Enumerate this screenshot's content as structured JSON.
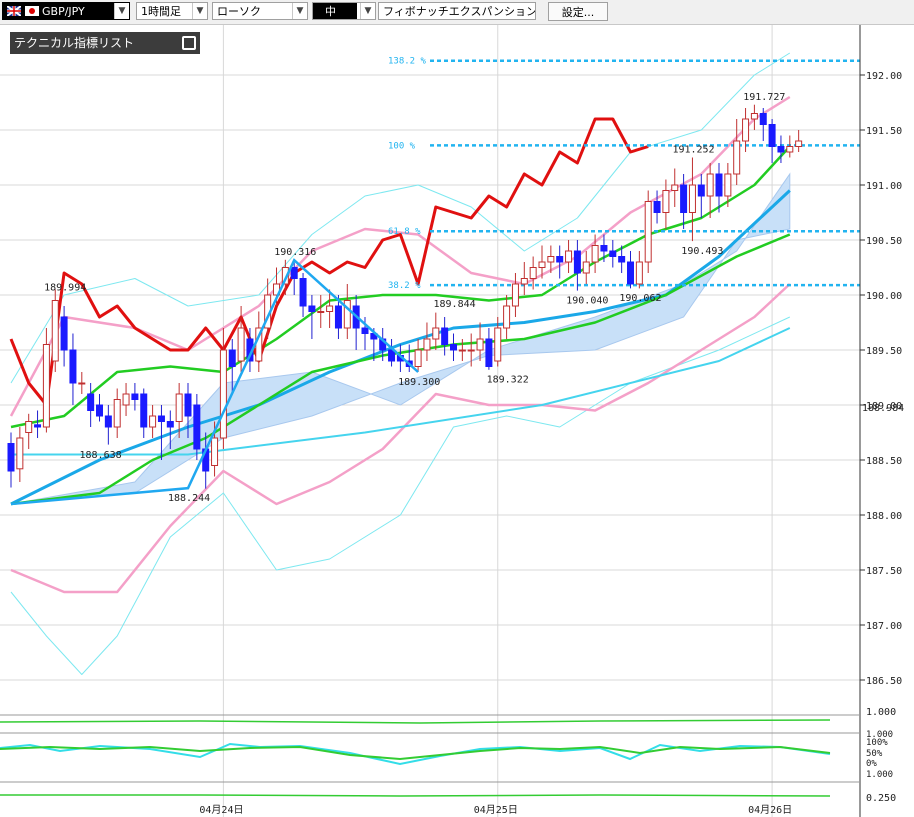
{
  "toolbar": {
    "pair": "GBP/JPY",
    "timeframe": "1時間足",
    "chart_type": "ローソク",
    "size": "中",
    "drawing_tool": "フィボナッチエクスパンション",
    "settings_label": "設定..."
  },
  "indicator_list": {
    "label": "テクニカル指標リスト"
  },
  "chart_data": {
    "type": "candlestick",
    "price_axis": {
      "min": 186.5,
      "max": 192.0,
      "ticks": [
        "192.00",
        "191.50",
        "191.00",
        "190.50",
        "190.00",
        "189.50",
        "189.00",
        "188.50",
        "188.00",
        "187.50",
        "187.00",
        "186.50"
      ]
    },
    "date_labels": [
      {
        "label": "04月24日",
        "index": 24
      },
      {
        "label": "04月25日",
        "index": 55
      },
      {
        "label": "04月26日",
        "index": 86
      }
    ],
    "fibonacci_expansion": [
      {
        "label": "138.2 %",
        "price": 192.13
      },
      {
        "label": "100 %",
        "price": 191.36
      },
      {
        "label": "61.8 %",
        "price": 190.58
      },
      {
        "label": "38.2 %",
        "price": 190.09
      }
    ],
    "price_labels": [
      {
        "text": "189.994",
        "index": 6,
        "price": 189.994,
        "pos": "above"
      },
      {
        "text": "188.638",
        "index": 10,
        "price": 188.638,
        "pos": "below"
      },
      {
        "text": "188.244",
        "index": 20,
        "price": 188.244,
        "pos": "below"
      },
      {
        "text": "190.316",
        "index": 32,
        "price": 190.316,
        "pos": "above"
      },
      {
        "text": "189.844",
        "index": 50,
        "price": 189.844,
        "pos": "above"
      },
      {
        "text": "189.300",
        "index": 46,
        "price": 189.3,
        "pos": "below"
      },
      {
        "text": "189.322",
        "index": 56,
        "price": 189.322,
        "pos": "below"
      },
      {
        "text": "190.040",
        "index": 65,
        "price": 190.04,
        "pos": "below"
      },
      {
        "text": "190.062",
        "index": 71,
        "price": 190.062,
        "pos": "below"
      },
      {
        "text": "191.252",
        "index": 77,
        "price": 191.252,
        "pos": "above"
      },
      {
        "text": "190.493",
        "index": 78,
        "price": 190.493,
        "pos": "below"
      },
      {
        "text": "191.727",
        "index": 85,
        "price": 191.727,
        "pos": "above"
      }
    ],
    "current_price_label": "188.984",
    "zigzag": [
      [
        0,
        188.1
      ],
      [
        20,
        188.244
      ],
      [
        32,
        190.316
      ],
      [
        46,
        189.3
      ]
    ],
    "candles": [
      [
        188.65,
        188.4,
        188.75,
        188.25
      ],
      [
        188.42,
        188.7,
        188.8,
        188.3
      ],
      [
        188.75,
        188.85,
        188.92,
        188.6
      ],
      [
        188.82,
        188.8,
        188.95,
        188.7
      ],
      [
        188.8,
        189.55,
        189.7,
        188.75
      ],
      [
        189.4,
        189.95,
        190.05,
        189.3
      ],
      [
        189.8,
        189.5,
        189.9,
        189.35
      ],
      [
        189.5,
        189.2,
        189.65,
        189.0
      ],
      [
        189.2,
        189.2,
        189.3,
        189.1
      ],
      [
        189.1,
        188.95,
        189.2,
        188.8
      ],
      [
        189.0,
        188.9,
        189.1,
        188.85
      ],
      [
        188.9,
        188.8,
        189.0,
        188.64
      ],
      [
        188.8,
        189.05,
        189.15,
        188.7
      ],
      [
        189.0,
        189.1,
        189.2,
        188.9
      ],
      [
        189.1,
        189.05,
        189.2,
        188.95
      ],
      [
        189.1,
        188.8,
        189.15,
        188.7
      ],
      [
        188.8,
        188.9,
        189.0,
        188.7
      ],
      [
        188.9,
        188.85,
        189.0,
        188.5
      ],
      [
        188.85,
        188.8,
        188.95,
        188.6
      ],
      [
        188.85,
        189.1,
        189.2,
        188.7
      ],
      [
        189.1,
        188.9,
        189.2,
        188.7
      ],
      [
        189.0,
        188.6,
        189.1,
        188.5
      ],
      [
        188.6,
        188.4,
        188.75,
        188.24
      ],
      [
        188.45,
        188.7,
        188.85,
        188.35
      ],
      [
        188.7,
        189.5,
        189.7,
        188.6
      ],
      [
        189.5,
        189.35,
        189.6,
        189.1
      ],
      [
        189.4,
        189.7,
        189.9,
        189.3
      ],
      [
        189.6,
        189.4,
        189.7,
        189.3
      ],
      [
        189.4,
        189.7,
        189.85,
        189.3
      ],
      [
        189.7,
        190.0,
        190.15,
        189.6
      ],
      [
        190.0,
        190.1,
        190.25,
        189.9
      ],
      [
        190.1,
        190.25,
        190.32,
        190.0
      ],
      [
        190.25,
        190.15,
        190.3,
        190.0
      ],
      [
        190.15,
        189.9,
        190.2,
        189.8
      ],
      [
        189.9,
        189.85,
        190.0,
        189.6
      ],
      [
        189.85,
        189.85,
        190.0,
        189.7
      ],
      [
        189.85,
        189.9,
        190.05,
        189.7
      ],
      [
        189.9,
        189.7,
        190.0,
        189.6
      ],
      [
        189.7,
        189.95,
        190.1,
        189.6
      ],
      [
        189.9,
        189.7,
        190.0,
        189.5
      ],
      [
        189.7,
        189.65,
        189.8,
        189.5
      ],
      [
        189.65,
        189.6,
        189.7,
        189.4
      ],
      [
        189.6,
        189.5,
        189.7,
        189.4
      ],
      [
        189.5,
        189.4,
        189.6,
        189.35
      ],
      [
        189.45,
        189.4,
        189.55,
        189.3
      ],
      [
        189.4,
        189.35,
        189.55,
        189.3
      ],
      [
        189.35,
        189.5,
        189.6,
        189.3
      ],
      [
        189.5,
        189.6,
        189.75,
        189.4
      ],
      [
        189.6,
        189.7,
        189.84,
        189.5
      ],
      [
        189.7,
        189.55,
        189.8,
        189.45
      ],
      [
        189.55,
        189.5,
        189.65,
        189.4
      ],
      [
        189.5,
        189.5,
        189.6,
        189.4
      ],
      [
        189.5,
        189.5,
        189.65,
        189.35
      ],
      [
        189.5,
        189.6,
        189.75,
        189.4
      ],
      [
        189.6,
        189.35,
        189.7,
        189.32
      ],
      [
        189.4,
        189.7,
        189.8,
        189.35
      ],
      [
        189.7,
        189.9,
        190.0,
        189.6
      ],
      [
        189.9,
        190.1,
        190.2,
        189.8
      ],
      [
        190.1,
        190.15,
        190.3,
        190.0
      ],
      [
        190.15,
        190.25,
        190.35,
        190.05
      ],
      [
        190.25,
        190.3,
        190.45,
        190.15
      ],
      [
        190.3,
        190.35,
        190.45,
        190.2
      ],
      [
        190.35,
        190.3,
        190.45,
        190.15
      ],
      [
        190.3,
        190.4,
        190.5,
        190.2
      ],
      [
        190.4,
        190.2,
        190.5,
        190.04
      ],
      [
        190.2,
        190.3,
        190.4,
        190.1
      ],
      [
        190.3,
        190.45,
        190.55,
        190.2
      ],
      [
        190.45,
        190.4,
        190.55,
        190.3
      ],
      [
        190.4,
        190.35,
        190.5,
        190.25
      ],
      [
        190.35,
        190.3,
        190.45,
        190.2
      ],
      [
        190.3,
        190.1,
        190.4,
        190.06
      ],
      [
        190.1,
        190.3,
        190.4,
        190.06
      ],
      [
        190.3,
        190.85,
        190.95,
        190.2
      ],
      [
        190.85,
        190.75,
        190.95,
        190.65
      ],
      [
        190.75,
        190.95,
        191.05,
        190.6
      ],
      [
        190.95,
        191.0,
        191.15,
        190.8
      ],
      [
        191.0,
        190.75,
        191.1,
        190.6
      ],
      [
        190.75,
        191.0,
        191.25,
        190.49
      ],
      [
        191.0,
        190.9,
        191.1,
        190.7
      ],
      [
        190.9,
        191.1,
        191.2,
        190.7
      ],
      [
        191.1,
        190.9,
        191.2,
        190.75
      ],
      [
        190.9,
        191.1,
        191.2,
        190.8
      ],
      [
        191.1,
        191.4,
        191.6,
        191.0
      ],
      [
        191.4,
        191.6,
        191.7,
        191.3
      ],
      [
        191.6,
        191.65,
        191.73,
        191.5
      ],
      [
        191.65,
        191.55,
        191.7,
        191.4
      ],
      [
        191.55,
        191.35,
        191.6,
        191.2
      ],
      [
        191.35,
        191.3,
        191.45,
        191.2
      ],
      [
        191.3,
        191.35,
        191.45,
        191.25
      ],
      [
        191.35,
        191.4,
        191.5,
        191.3
      ]
    ],
    "overlays": {
      "red": [
        [
          0,
          189.6
        ],
        [
          2,
          189.2
        ],
        [
          4,
          189.0
        ],
        [
          6,
          190.2
        ],
        [
          8,
          190.1
        ],
        [
          10,
          189.8
        ],
        [
          12,
          189.9
        ],
        [
          14,
          189.7
        ],
        [
          16,
          189.6
        ],
        [
          18,
          189.5
        ],
        [
          20,
          189.5
        ],
        [
          22,
          189.7
        ],
        [
          24,
          189.5
        ],
        [
          26,
          189.8
        ],
        [
          28,
          189.4
        ],
        [
          30,
          189.9
        ],
        [
          32,
          190.2
        ],
        [
          34,
          190.3
        ],
        [
          36,
          190.2
        ],
        [
          38,
          190.3
        ],
        [
          40,
          190.25
        ],
        [
          42,
          190.5
        ],
        [
          44,
          190.55
        ],
        [
          46,
          190.1
        ],
        [
          48,
          190.8
        ],
        [
          50,
          190.75
        ],
        [
          52,
          190.7
        ],
        [
          54,
          190.9
        ],
        [
          56,
          190.8
        ],
        [
          58,
          191.1
        ],
        [
          60,
          191.0
        ],
        [
          62,
          191.3
        ],
        [
          64,
          191.2
        ],
        [
          66,
          191.6
        ],
        [
          68,
          191.6
        ],
        [
          70,
          191.3
        ],
        [
          72,
          191.35
        ]
      ],
      "green": [
        [
          0,
          188.1
        ],
        [
          10,
          188.2
        ],
        [
          16,
          188.5
        ],
        [
          22,
          188.7
        ],
        [
          28,
          189.0
        ],
        [
          34,
          189.3
        ],
        [
          42,
          189.45
        ],
        [
          50,
          189.55
        ],
        [
          58,
          189.6
        ],
        [
          66,
          189.75
        ],
        [
          74,
          190.0
        ],
        [
          82,
          190.35
        ],
        [
          88,
          190.55
        ]
      ],
      "green_fast": [
        [
          0,
          188.8
        ],
        [
          6,
          188.9
        ],
        [
          12,
          189.3
        ],
        [
          18,
          189.35
        ],
        [
          24,
          189.3
        ],
        [
          30,
          189.6
        ],
        [
          36,
          189.95
        ],
        [
          42,
          190.0
        ],
        [
          48,
          190.0
        ],
        [
          54,
          189.95
        ],
        [
          60,
          190.0
        ],
        [
          66,
          190.3
        ],
        [
          72,
          190.55
        ],
        [
          78,
          190.7
        ],
        [
          84,
          191.0
        ],
        [
          88,
          191.35
        ]
      ],
      "blue": [
        [
          0,
          188.1
        ],
        [
          10,
          188.5
        ],
        [
          20,
          188.8
        ],
        [
          28,
          189.0
        ],
        [
          36,
          189.3
        ],
        [
          44,
          189.55
        ],
        [
          50,
          189.7
        ],
        [
          58,
          189.75
        ],
        [
          66,
          189.85
        ],
        [
          74,
          190.0
        ],
        [
          80,
          190.35
        ],
        [
          88,
          190.95
        ]
      ],
      "cyan_slow": [
        [
          0,
          188.55
        ],
        [
          20,
          188.55
        ],
        [
          40,
          188.75
        ],
        [
          60,
          189.0
        ],
        [
          80,
          189.4
        ],
        [
          88,
          189.7
        ]
      ],
      "bb_up2": [
        [
          0,
          189.2
        ],
        [
          6,
          190.0
        ],
        [
          14,
          190.15
        ],
        [
          20,
          189.9
        ],
        [
          28,
          190.0
        ],
        [
          34,
          190.55
        ],
        [
          40,
          190.9
        ],
        [
          46,
          191.0
        ],
        [
          52,
          190.8
        ],
        [
          58,
          190.4
        ],
        [
          64,
          190.7
        ],
        [
          70,
          191.3
        ],
        [
          78,
          191.5
        ],
        [
          84,
          192.0
        ],
        [
          88,
          192.2
        ]
      ],
      "bb_up1": [
        [
          0,
          188.9
        ],
        [
          6,
          189.8
        ],
        [
          14,
          189.7
        ],
        [
          20,
          189.5
        ],
        [
          28,
          189.9
        ],
        [
          34,
          190.4
        ],
        [
          40,
          190.6
        ],
        [
          46,
          190.55
        ],
        [
          52,
          190.2
        ],
        [
          58,
          190.1
        ],
        [
          64,
          190.35
        ],
        [
          70,
          190.75
        ],
        [
          78,
          191.1
        ],
        [
          84,
          191.6
        ],
        [
          88,
          191.8
        ]
      ],
      "bb_lo1": [
        [
          0,
          187.5
        ],
        [
          6,
          187.3
        ],
        [
          12,
          187.3
        ],
        [
          18,
          187.9
        ],
        [
          24,
          188.4
        ],
        [
          30,
          188.1
        ],
        [
          36,
          188.3
        ],
        [
          42,
          188.6
        ],
        [
          48,
          189.1
        ],
        [
          54,
          189.0
        ],
        [
          60,
          189.0
        ],
        [
          66,
          188.95
        ],
        [
          72,
          189.2
        ],
        [
          78,
          189.5
        ],
        [
          84,
          189.8
        ],
        [
          88,
          190.1
        ]
      ],
      "bb_lo2": [
        [
          0,
          187.3
        ],
        [
          4,
          186.9
        ],
        [
          8,
          186.55
        ],
        [
          12,
          186.9
        ],
        [
          18,
          187.8
        ],
        [
          24,
          188.2
        ],
        [
          30,
          187.5
        ],
        [
          36,
          187.6
        ],
        [
          44,
          188.0
        ],
        [
          50,
          188.8
        ],
        [
          56,
          188.9
        ],
        [
          62,
          188.8
        ],
        [
          70,
          189.2
        ],
        [
          80,
          189.5
        ],
        [
          88,
          189.8
        ]
      ],
      "cloud_a": [
        [
          0,
          188.1
        ],
        [
          14,
          188.3
        ],
        [
          24,
          189.2
        ],
        [
          34,
          189.3
        ],
        [
          44,
          189.0
        ],
        [
          54,
          189.5
        ],
        [
          66,
          189.8
        ],
        [
          76,
          190.1
        ],
        [
          82,
          190.4
        ],
        [
          88,
          191.1
        ]
      ],
      "cloud_b": [
        [
          0,
          188.1
        ],
        [
          14,
          188.2
        ],
        [
          24,
          188.7
        ],
        [
          34,
          188.9
        ],
        [
          44,
          189.2
        ],
        [
          54,
          189.45
        ],
        [
          66,
          189.5
        ],
        [
          76,
          189.8
        ],
        [
          82,
          190.5
        ],
        [
          88,
          190.6
        ]
      ]
    },
    "sub_indicators": {
      "panel1": {
        "axis_label": "1.000"
      },
      "panel2": {
        "axis_labels": [
          "1.000",
          "100%",
          "50%",
          "0%",
          "1.000"
        ]
      },
      "panel3": {
        "axis_label": "0.250"
      }
    }
  }
}
